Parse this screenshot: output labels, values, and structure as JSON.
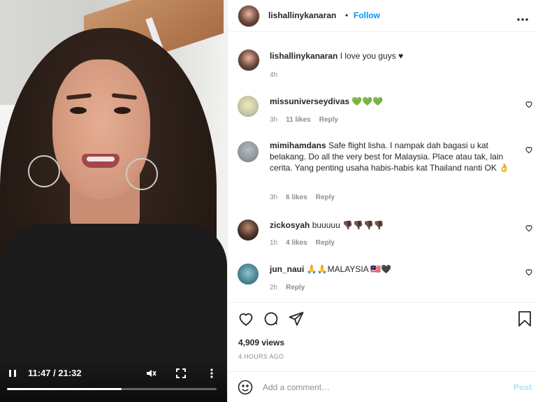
{
  "video": {
    "time": "11:47 / 21:32",
    "progress_fraction": 0.547
  },
  "header": {
    "username": "lishallinykanaran",
    "separator": "•",
    "follow_label": "Follow",
    "more_icon": "more-horizontal-icon"
  },
  "caption": {
    "username": "lishallinykanaran",
    "text": "I love you guys ♥",
    "time": "4h"
  },
  "comments": [
    {
      "username": "missuniverseydivas",
      "text": "💚💚💚",
      "time": "3h",
      "likes": "11 likes",
      "reply": "Reply"
    },
    {
      "username": "mimihamdans",
      "text": "Safe flight lisha. I nampak dah bagasi u kat belakang. Do all the very best for Malaysia. Place atau tak, lain cerita. Yang penting usaha habis-habis kat Thailand nanti OK 👌",
      "time": "3h",
      "likes": "6 likes",
      "reply": "Reply"
    },
    {
      "username": "zickosyah",
      "text": "buuuuu 👎🏿👎🏿👎🏿👎🏿",
      "time": "1h",
      "likes": "4 likes",
      "reply": "Reply"
    },
    {
      "username": "jun_naui",
      "text": "🙏🙏MALAYSIA 🇲🇾🖤",
      "time": "2h",
      "likes": "",
      "reply": "Reply"
    }
  ],
  "actions": {
    "views": "4,909 views",
    "ago": "4 HOURS AGO"
  },
  "add_comment": {
    "placeholder": "Add a comment…",
    "post_label": "Post"
  },
  "colors": {
    "accent": "#0095f6",
    "post_disabled": "#b2dffc",
    "secondary_text": "#8e8e8e"
  }
}
